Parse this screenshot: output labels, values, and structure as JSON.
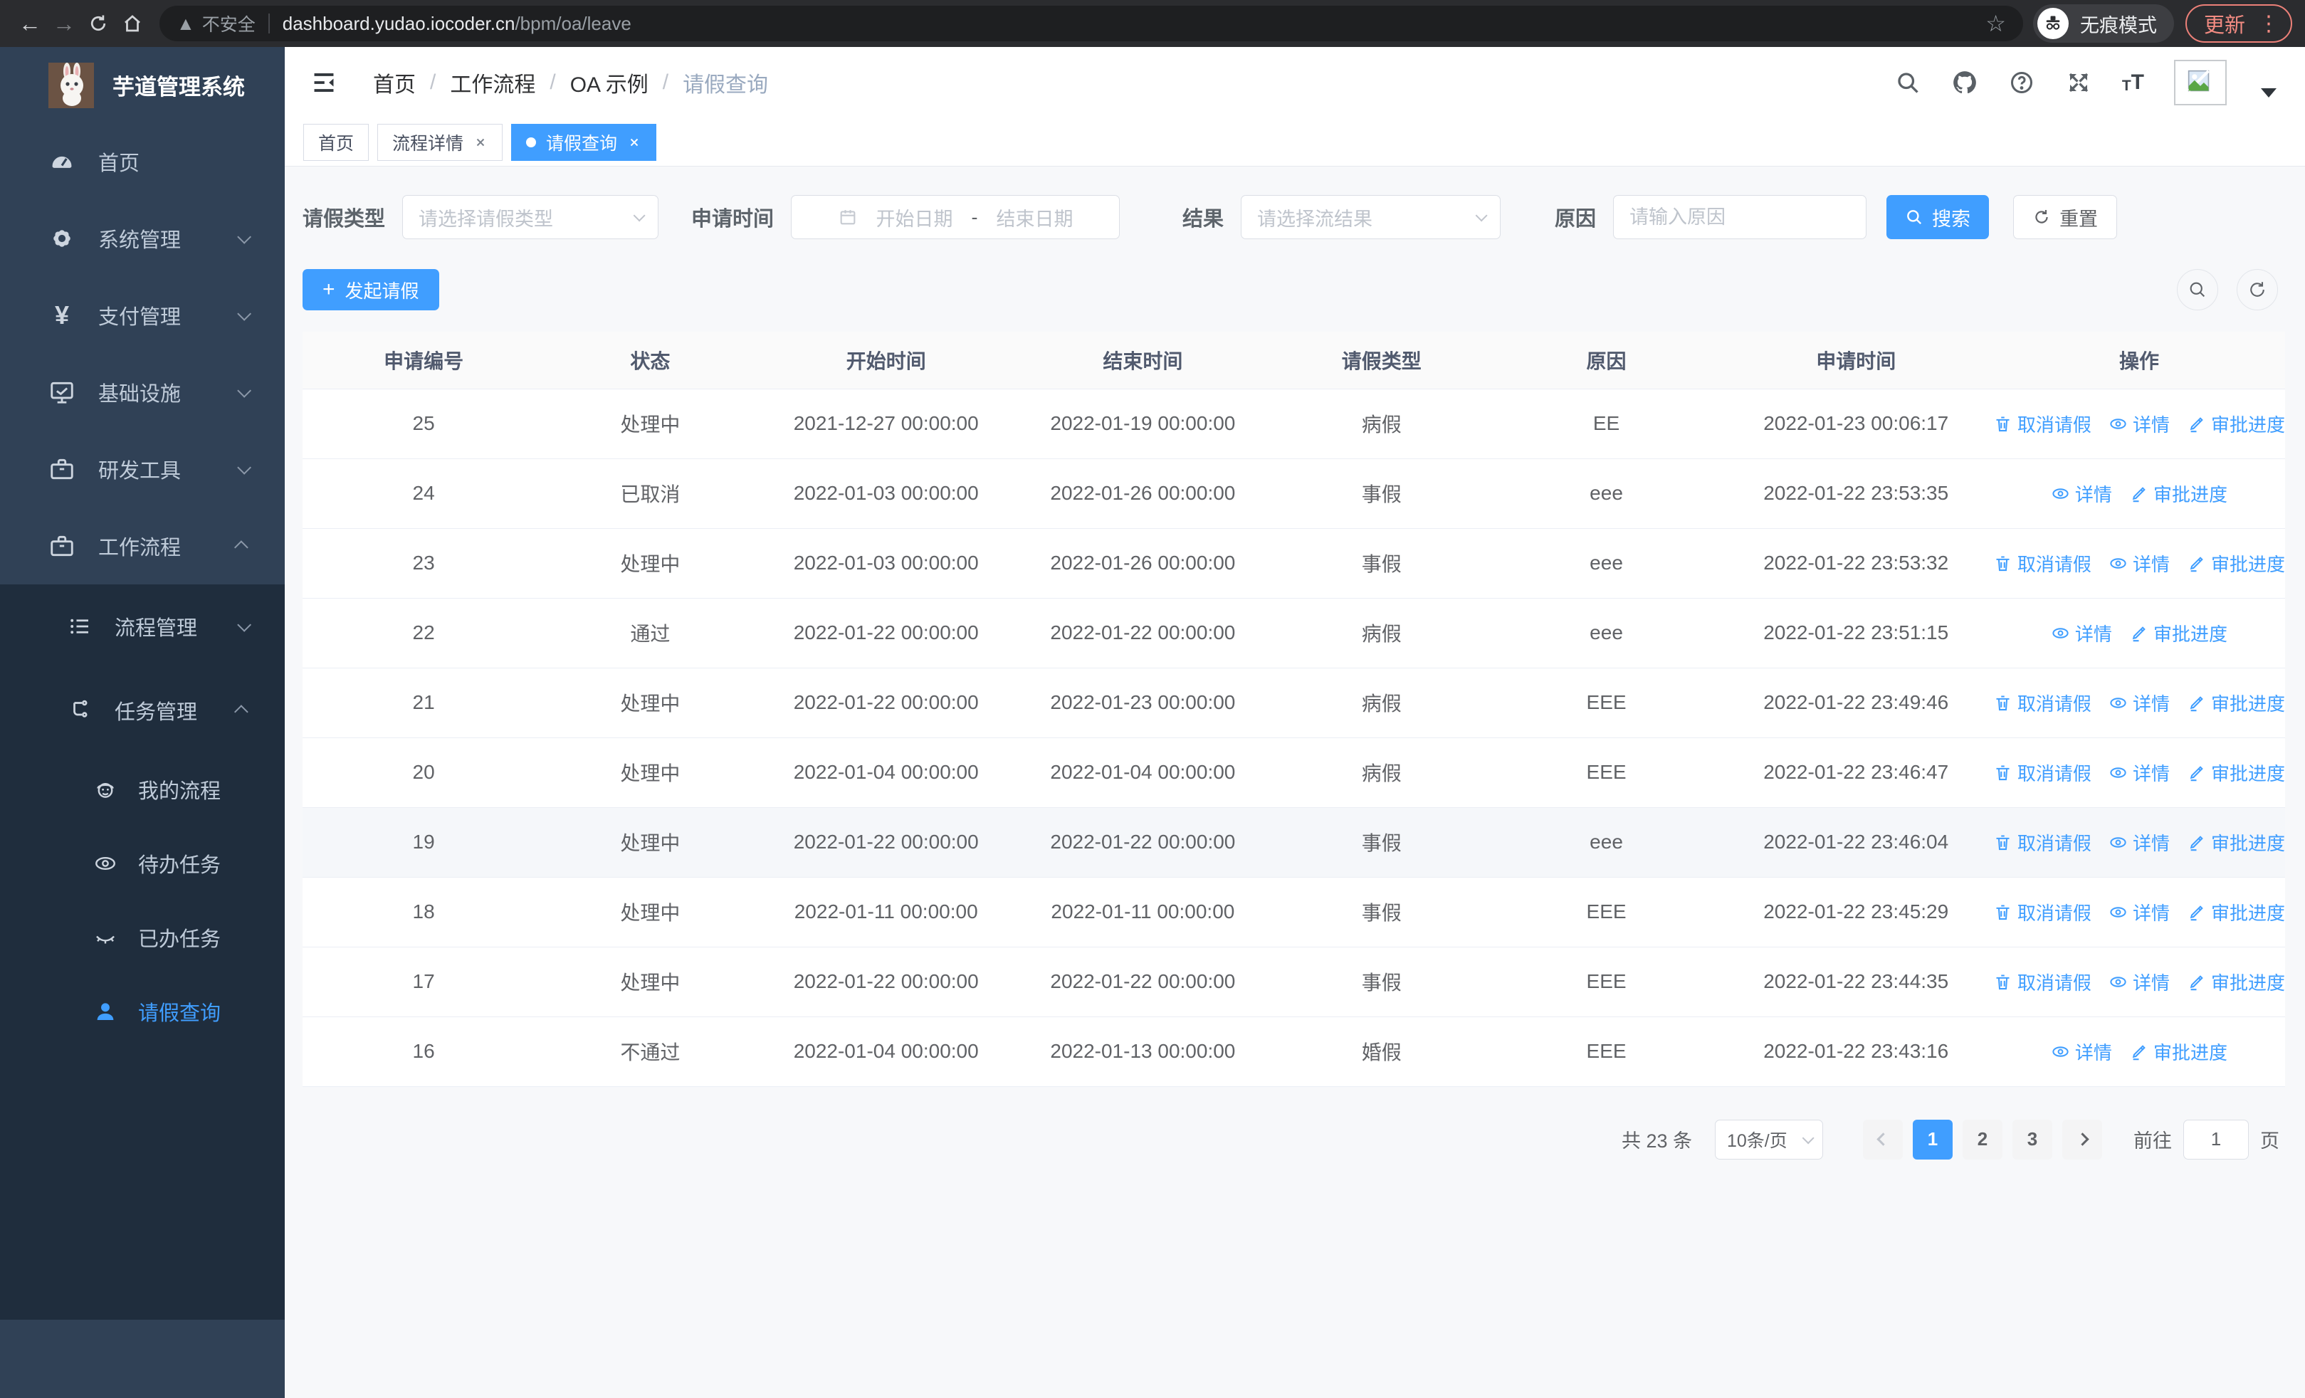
{
  "browser": {
    "security_label": "不安全",
    "url_domain": "dashboard.yudao.iocoder.cn",
    "url_path": "/bpm/oa/leave",
    "incognito_label": "无痕模式",
    "update_label": "更新",
    "nav_icons": [
      "back-icon",
      "forward-icon",
      "reload-icon",
      "home-icon",
      "warning-icon",
      "bookmark-star-icon",
      "incognito-icon",
      "menu-dots-icon"
    ]
  },
  "colors": {
    "accent": "#409eff",
    "sidebar_bg": "#304156",
    "submenu_bg": "#1f2d3d",
    "update_accent": "#f28b82"
  },
  "sidebar": {
    "title": "芋道管理系统",
    "items": [
      {
        "label": "首页",
        "icon": "dashboard-icon",
        "expandable": false
      },
      {
        "label": "系统管理",
        "icon": "gear-icon",
        "state": "collapsed"
      },
      {
        "label": "支付管理",
        "icon": "yen-icon",
        "state": "collapsed"
      },
      {
        "label": "基础设施",
        "icon": "monitor-icon",
        "state": "collapsed"
      },
      {
        "label": "研发工具",
        "icon": "toolbox-icon",
        "state": "collapsed"
      },
      {
        "label": "工作流程",
        "icon": "toolbox-icon",
        "state": "expanded"
      }
    ],
    "submenu": [
      {
        "label": "流程管理",
        "icon": "list-icon",
        "state": "collapsed",
        "level": 2
      },
      {
        "label": "任务管理",
        "icon": "flow-icon",
        "state": "expanded",
        "level": 2
      },
      {
        "label": "我的流程",
        "icon": "robot-icon",
        "level": 3,
        "active": false
      },
      {
        "label": "待办任务",
        "icon": "eye-icon",
        "level": 3,
        "active": false
      },
      {
        "label": "已办任务",
        "icon": "eye-closed-icon",
        "level": 3,
        "active": false
      },
      {
        "label": "请假查询",
        "icon": "user-icon",
        "level": 3,
        "active": true
      }
    ]
  },
  "header": {
    "breadcrumb": [
      "首页",
      "工作流程",
      "OA 示例",
      "请假查询"
    ],
    "separator": "/",
    "icons": [
      "menu-fold-icon",
      "search-icon",
      "github-icon",
      "help-icon",
      "fullscreen-icon",
      "font-size-icon",
      "avatar-broken-image",
      "dropdown-caret-icon"
    ]
  },
  "tabs": [
    {
      "label": "首页",
      "closable": false,
      "active": false
    },
    {
      "label": "流程详情",
      "closable": true,
      "active": false
    },
    {
      "label": "请假查询",
      "closable": true,
      "active": true
    }
  ],
  "filters": {
    "leave_type_label": "请假类型",
    "leave_type_placeholder": "请选择请假类型",
    "apply_time_label": "申请时间",
    "date_start_placeholder": "开始日期",
    "date_separator": "-",
    "date_end_placeholder": "结束日期",
    "result_label": "结果",
    "result_placeholder": "请选择流结果",
    "reason_label": "原因",
    "reason_placeholder": "请输入原因",
    "search_label": "搜索",
    "reset_label": "重置"
  },
  "toolbar": {
    "create_label": "发起请假"
  },
  "table": {
    "columns": [
      "申请编号",
      "状态",
      "开始时间",
      "结束时间",
      "请假类型",
      "原因",
      "申请时间",
      "操作"
    ],
    "action_labels": {
      "cancel": "取消请假",
      "detail": "详情",
      "progress": "审批进度"
    },
    "rows": [
      {
        "id": "25",
        "status": "处理中",
        "start": "2021-12-27 00:00:00",
        "end": "2022-01-19 00:00:00",
        "type": "病假",
        "reason": "EE",
        "applied": "2022-01-23 00:06:17",
        "actions": [
          "cancel",
          "detail",
          "progress"
        ],
        "hover": false
      },
      {
        "id": "24",
        "status": "已取消",
        "start": "2022-01-03 00:00:00",
        "end": "2022-01-26 00:00:00",
        "type": "事假",
        "reason": "eee",
        "applied": "2022-01-22 23:53:35",
        "actions": [
          "detail",
          "progress"
        ],
        "hover": false
      },
      {
        "id": "23",
        "status": "处理中",
        "start": "2022-01-03 00:00:00",
        "end": "2022-01-26 00:00:00",
        "type": "事假",
        "reason": "eee",
        "applied": "2022-01-22 23:53:32",
        "actions": [
          "cancel",
          "detail",
          "progress"
        ],
        "hover": false
      },
      {
        "id": "22",
        "status": "通过",
        "start": "2022-01-22 00:00:00",
        "end": "2022-01-22 00:00:00",
        "type": "病假",
        "reason": "eee",
        "applied": "2022-01-22 23:51:15",
        "actions": [
          "detail",
          "progress"
        ],
        "hover": false
      },
      {
        "id": "21",
        "status": "处理中",
        "start": "2022-01-22 00:00:00",
        "end": "2022-01-23 00:00:00",
        "type": "病假",
        "reason": "EEE",
        "applied": "2022-01-22 23:49:46",
        "actions": [
          "cancel",
          "detail",
          "progress"
        ],
        "hover": false
      },
      {
        "id": "20",
        "status": "处理中",
        "start": "2022-01-04 00:00:00",
        "end": "2022-01-04 00:00:00",
        "type": "病假",
        "reason": "EEE",
        "applied": "2022-01-22 23:46:47",
        "actions": [
          "cancel",
          "detail",
          "progress"
        ],
        "hover": false
      },
      {
        "id": "19",
        "status": "处理中",
        "start": "2022-01-22 00:00:00",
        "end": "2022-01-22 00:00:00",
        "type": "事假",
        "reason": "eee",
        "applied": "2022-01-22 23:46:04",
        "actions": [
          "cancel",
          "detail",
          "progress"
        ],
        "hover": true
      },
      {
        "id": "18",
        "status": "处理中",
        "start": "2022-01-11 00:00:00",
        "end": "2022-01-11 00:00:00",
        "type": "事假",
        "reason": "EEE",
        "applied": "2022-01-22 23:45:29",
        "actions": [
          "cancel",
          "detail",
          "progress"
        ],
        "hover": false
      },
      {
        "id": "17",
        "status": "处理中",
        "start": "2022-01-22 00:00:00",
        "end": "2022-01-22 00:00:00",
        "type": "事假",
        "reason": "EEE",
        "applied": "2022-01-22 23:44:35",
        "actions": [
          "cancel",
          "detail",
          "progress"
        ],
        "hover": false
      },
      {
        "id": "16",
        "status": "不通过",
        "start": "2022-01-04 00:00:00",
        "end": "2022-01-13 00:00:00",
        "type": "婚假",
        "reason": "EEE",
        "applied": "2022-01-22 23:43:16",
        "actions": [
          "detail",
          "progress"
        ],
        "hover": false
      }
    ]
  },
  "pagination": {
    "total_label": "共 23 条",
    "page_size": "10条/页",
    "pages": [
      "1",
      "2",
      "3"
    ],
    "active_page": "1",
    "goto_label": "前往",
    "goto_value": "1",
    "page_unit": "页"
  }
}
